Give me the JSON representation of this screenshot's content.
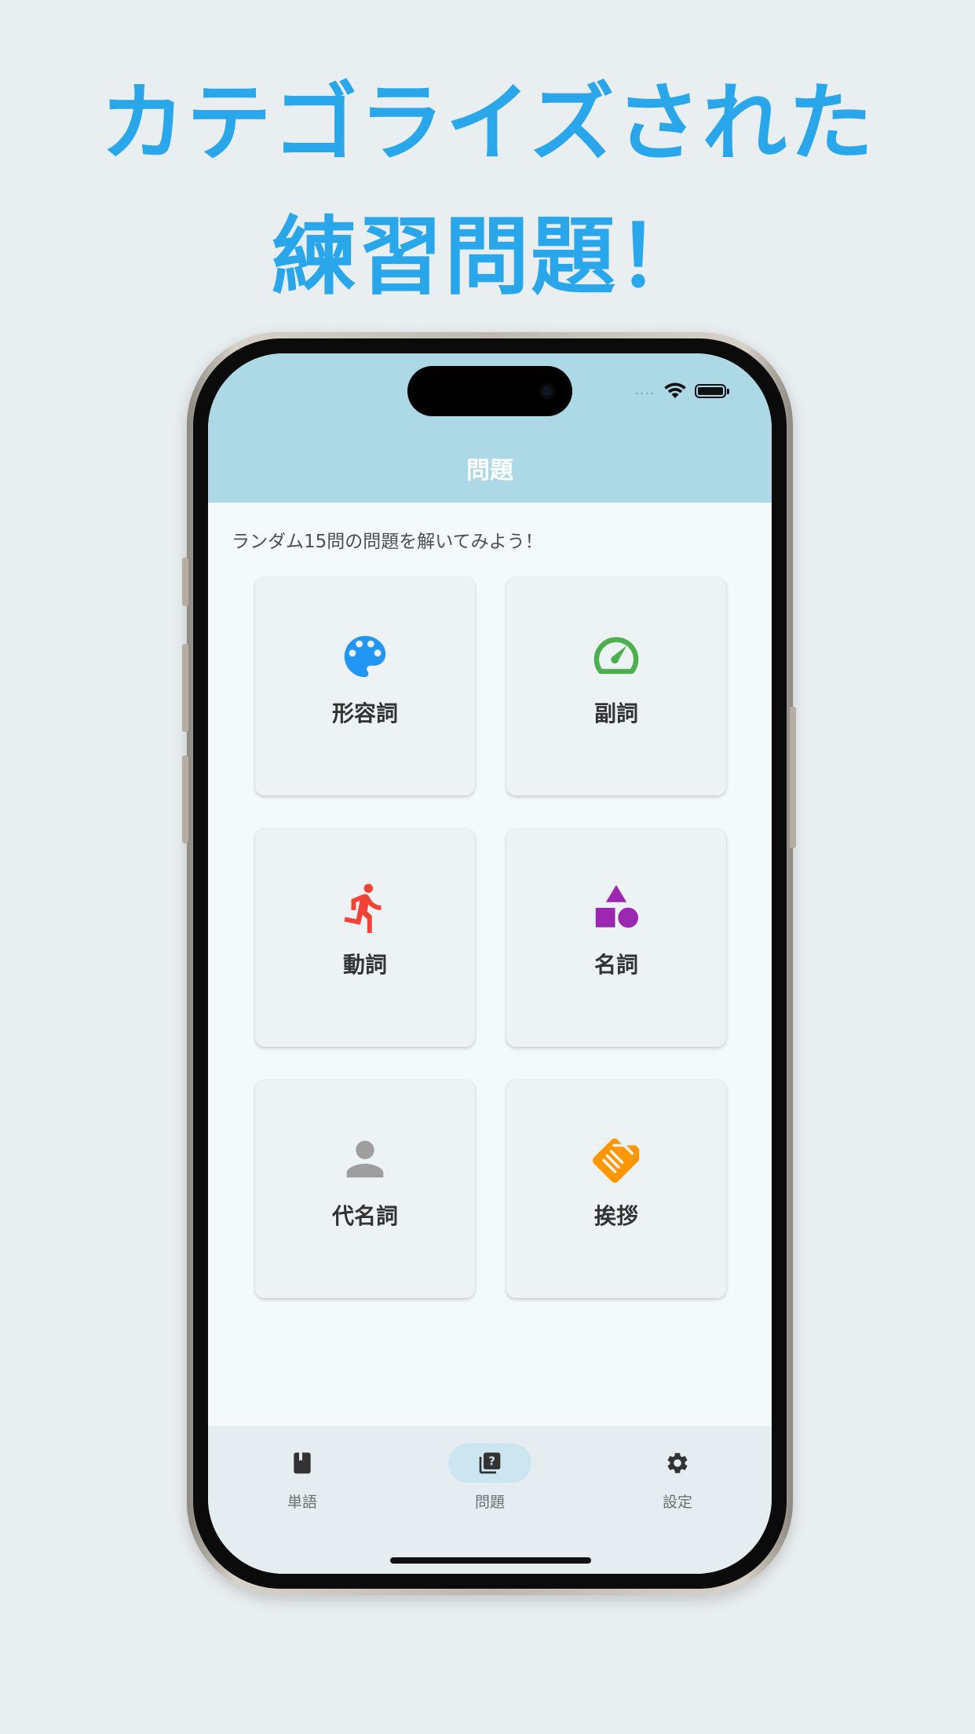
{
  "headline": {
    "line1": "カテゴライズされた",
    "line2": "練習問題！"
  },
  "status_bar": {
    "signal": "....",
    "wifi_icon": "wifi-icon",
    "battery_icon": "battery-icon"
  },
  "app_bar": {
    "title": "問題"
  },
  "main": {
    "subtitle": "ランダム15問の問題を解いてみよう！",
    "categories": [
      {
        "label": "形容詞",
        "icon": "palette-icon",
        "color": "#2196f3"
      },
      {
        "label": "副詞",
        "icon": "speedometer-icon",
        "color": "#4caf50"
      },
      {
        "label": "動詞",
        "icon": "running-person-icon",
        "color": "#f44336"
      },
      {
        "label": "名詞",
        "icon": "shapes-icon",
        "color": "#9c27b0"
      },
      {
        "label": "代名詞",
        "icon": "person-icon",
        "color": "#9e9e9e"
      },
      {
        "label": "挨拶",
        "icon": "handshake-icon",
        "color": "#ff9800"
      }
    ]
  },
  "bottom_nav": {
    "items": [
      {
        "label": "単語",
        "icon": "book-icon",
        "active": false
      },
      {
        "label": "問題",
        "icon": "quiz-icon",
        "active": true
      },
      {
        "label": "設定",
        "icon": "gear-icon",
        "active": false
      }
    ]
  },
  "colors": {
    "headline": "#2aa6ea",
    "app_bar": "#add8e6",
    "background": "#e9eef0"
  }
}
